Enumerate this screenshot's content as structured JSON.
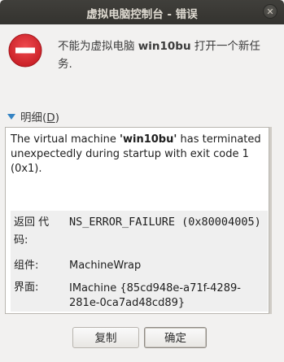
{
  "window": {
    "title": "虚拟电脑控制台 - 错误",
    "close_glyph": "✕"
  },
  "icons": {
    "error": "error-circle-icon",
    "expander": "triangle-down-icon",
    "close": "close-icon"
  },
  "message": {
    "prefix": "不能为虚拟电脑 ",
    "vm_name": "win10bu",
    "suffix": " 打开一个新任务."
  },
  "details": {
    "toggle_label": "明细(",
    "toggle_mnemonic": "D",
    "toggle_close": ")",
    "text_prefix": "The virtual machine ",
    "text_vm": "'win10bu'",
    "text_suffix": " has terminated unexpectedly during startup with exit code 1 (0x1).",
    "rows": [
      {
        "label": "返回 代码:",
        "value": "NS_ERROR_FAILURE (0x80004005)"
      },
      {
        "label": "组件:",
        "value": "MachineWrap"
      },
      {
        "label": "界面:",
        "value": "IMachine {85cd948e-a71f-4289-281e-0ca7ad48cd89}"
      }
    ]
  },
  "buttons": {
    "copy": "复制",
    "ok": "确定"
  },
  "colors": {
    "error_red": "#d8262c",
    "titlebar": "#3a3935",
    "expander_blue": "#3584c4"
  }
}
